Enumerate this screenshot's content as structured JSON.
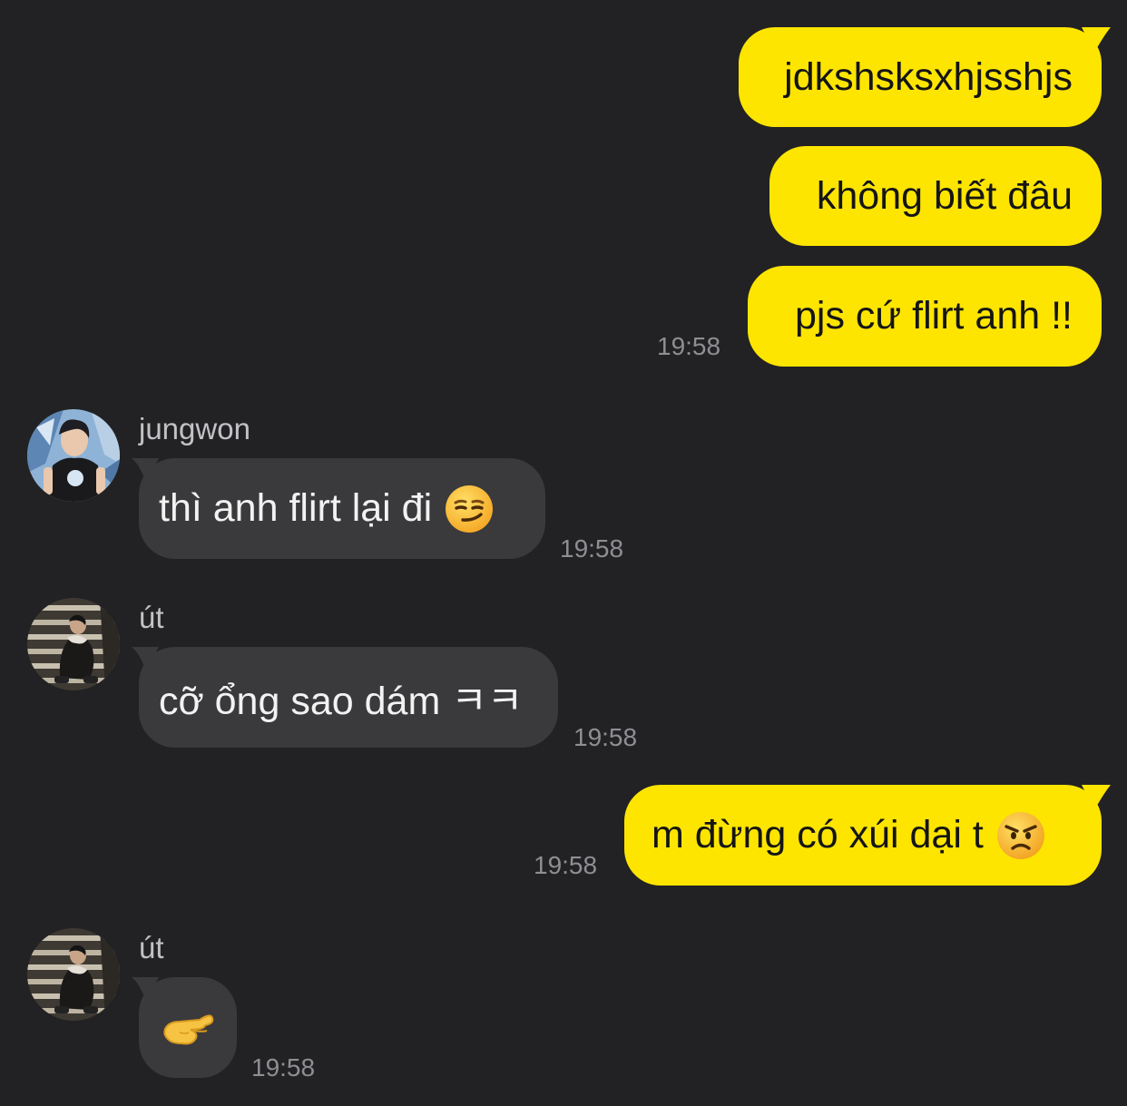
{
  "messages": [
    {
      "dir": "out",
      "text": "jdkshsksxhjsshjs"
    },
    {
      "dir": "out",
      "text": "không biết đâu"
    },
    {
      "dir": "out",
      "text": "pjs cứ flirt anh !!",
      "time": "19:58"
    },
    {
      "dir": "in",
      "sender": "jungwon",
      "text": "thì anh flirt lại đi",
      "emoji": "smirking-face-emoji",
      "time": "19:58"
    },
    {
      "dir": "in",
      "sender": "út",
      "text": "cỡ ổng sao dám ㅋㅋ",
      "time": "19:58"
    },
    {
      "dir": "out",
      "text": "m đừng có xúi dại t",
      "emoji": "angry-face-emoji",
      "time": "19:58"
    },
    {
      "dir": "in",
      "sender": "út",
      "emoji": "pinching-hand-emoji",
      "time": "19:58"
    }
  ],
  "colors": {
    "background": "#222224",
    "outgoing_bubble": "#FEE500",
    "incoming_bubble": "#3A3A3C",
    "timestamp": "#8E8E93",
    "sender_name": "#C2C2C6"
  }
}
